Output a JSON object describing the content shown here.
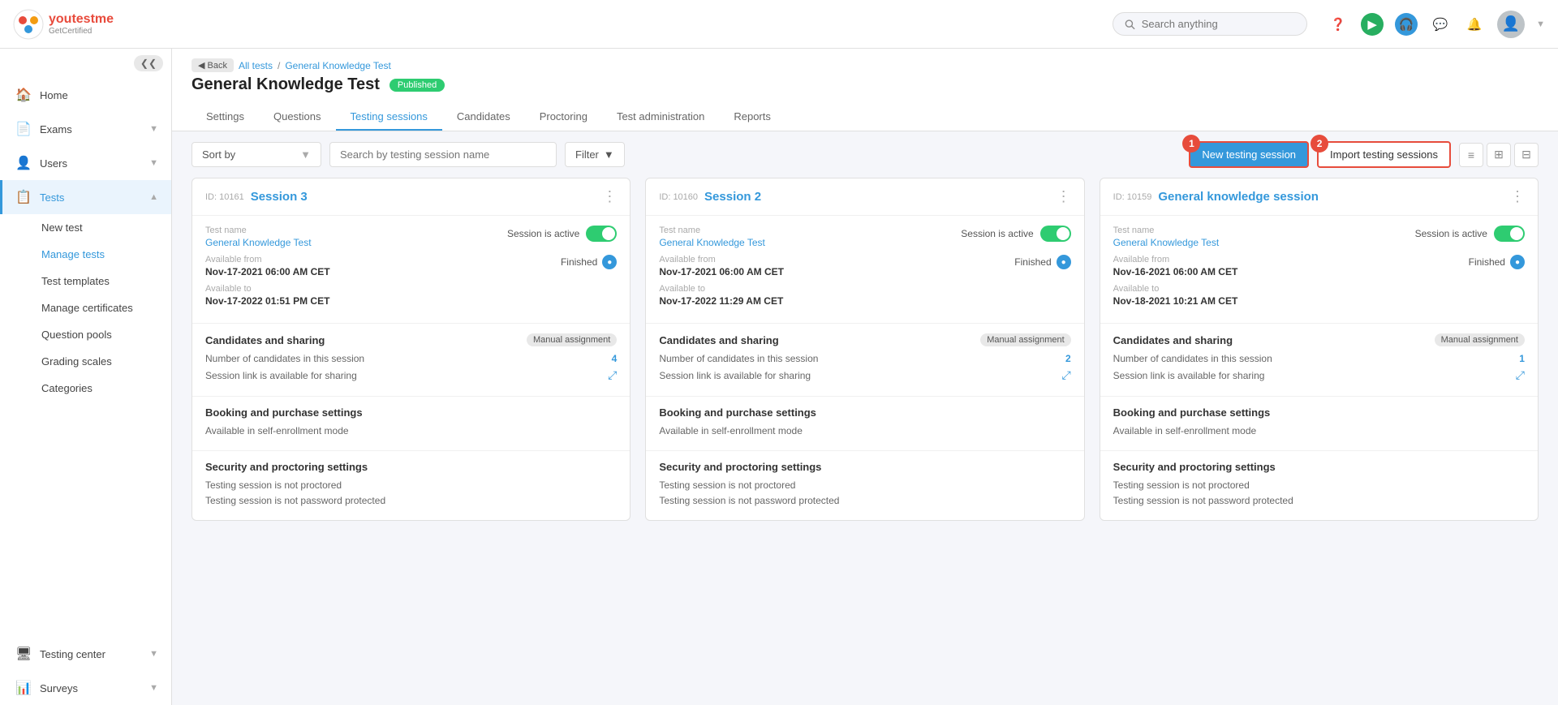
{
  "app": {
    "logo_brand": "youtestme",
    "logo_sub": "GetCertified"
  },
  "header": {
    "search_placeholder": "Search anything",
    "back_label": "◀ Back",
    "breadcrumb_all_tests": "All tests",
    "breadcrumb_current": "General Knowledge Test",
    "page_title": "General Knowledge Test",
    "status": "Published",
    "tabs": [
      {
        "label": "Settings",
        "active": false
      },
      {
        "label": "Questions",
        "active": false
      },
      {
        "label": "Testing sessions",
        "active": true
      },
      {
        "label": "Candidates",
        "active": false
      },
      {
        "label": "Proctoring",
        "active": false
      },
      {
        "label": "Test administration",
        "active": false
      },
      {
        "label": "Reports",
        "active": false
      }
    ]
  },
  "toolbar": {
    "sort_label": "Sort by",
    "search_placeholder": "Search by testing session name",
    "filter_label": "Filter",
    "new_session_label": "New testing session",
    "import_session_label": "Import testing sessions",
    "badge_new": "1",
    "badge_import": "2"
  },
  "sidebar": {
    "items": [
      {
        "label": "Home",
        "icon": "🏠",
        "active": false,
        "has_arrow": false
      },
      {
        "label": "Exams",
        "icon": "📄",
        "active": false,
        "has_arrow": true
      },
      {
        "label": "Users",
        "icon": "👤",
        "active": false,
        "has_arrow": true
      },
      {
        "label": "Tests",
        "icon": "📋",
        "active": true,
        "has_arrow": true
      }
    ],
    "sub_items": [
      {
        "label": "New test",
        "active": false
      },
      {
        "label": "Manage tests",
        "active": true
      },
      {
        "label": "Test templates",
        "active": false
      },
      {
        "label": "Manage certificates",
        "active": false
      },
      {
        "label": "Question pools",
        "active": false
      },
      {
        "label": "Grading scales",
        "active": false
      },
      {
        "label": "Categories",
        "active": false
      }
    ],
    "bottom_items": [
      {
        "label": "Testing center",
        "icon": "🖥",
        "active": false,
        "has_arrow": true
      },
      {
        "label": "Surveys",
        "icon": "📊",
        "active": false,
        "has_arrow": true
      }
    ]
  },
  "sessions": [
    {
      "id": "ID: 10161",
      "title": "Session 3",
      "test_name_label": "Test name",
      "test_name": "General Knowledge Test",
      "session_active_label": "Session is active",
      "available_from_label": "Available from",
      "available_from": "Nov-17-2021 06:00 AM CET",
      "finished_label": "Finished",
      "available_to_label": "Available to",
      "available_to": "Nov-17-2022 01:51 PM CET",
      "candidates_section": "Candidates and sharing",
      "assignment_badge": "Manual assignment",
      "candidates_label": "Number of candidates in this session",
      "candidates_count": "4",
      "link_label": "Session link is available for sharing",
      "booking_section": "Booking and purchase settings",
      "booking_desc": "Available in self-enrollment mode",
      "security_section": "Security and proctoring settings",
      "security_desc1": "Testing session is not proctored",
      "security_desc2": "Testing session is not password protected"
    },
    {
      "id": "ID: 10160",
      "title": "Session 2",
      "test_name_label": "Test name",
      "test_name": "General Knowledge Test",
      "session_active_label": "Session is active",
      "available_from_label": "Available from",
      "available_from": "Nov-17-2021 06:00 AM CET",
      "finished_label": "Finished",
      "available_to_label": "Available to",
      "available_to": "Nov-17-2022 11:29 AM CET",
      "candidates_section": "Candidates and sharing",
      "assignment_badge": "Manual assignment",
      "candidates_label": "Number of candidates in this session",
      "candidates_count": "2",
      "link_label": "Session link is available for sharing",
      "booking_section": "Booking and purchase settings",
      "booking_desc": "Available in self-enrollment mode",
      "security_section": "Security and proctoring settings",
      "security_desc1": "Testing session is not proctored",
      "security_desc2": "Testing session is not password protected"
    },
    {
      "id": "ID: 10159",
      "title": "General knowledge session",
      "test_name_label": "Test name",
      "test_name": "General Knowledge Test",
      "session_active_label": "Session is active",
      "available_from_label": "Available from",
      "available_from": "Nov-16-2021 06:00 AM CET",
      "finished_label": "Finished",
      "available_to_label": "Available to",
      "available_to": "Nov-18-2021 10:21 AM CET",
      "candidates_section": "Candidates and sharing",
      "assignment_badge": "Manual assignment",
      "candidates_label": "Number of candidates in this session",
      "candidates_count": "1",
      "link_label": "Session link is available for sharing",
      "booking_section": "Booking and purchase settings",
      "booking_desc": "Available in self-enrollment mode",
      "security_section": "Security and proctoring settings",
      "security_desc1": "Testing session is not proctored",
      "security_desc2": "Testing session is not password protected"
    }
  ]
}
